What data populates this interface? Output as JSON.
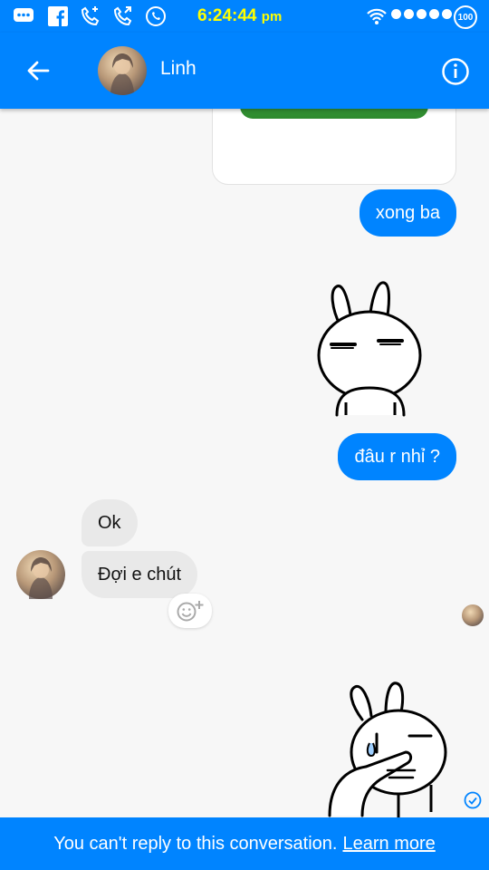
{
  "status_bar": {
    "time": "6:24:44",
    "ampm": "pm",
    "battery": "100",
    "icons": [
      "chat-bubble-icon",
      "facebook-icon",
      "call-icon",
      "call-icon",
      "whatsapp-icon",
      "wifi-icon",
      "signal-icon",
      "battery-icon"
    ]
  },
  "header": {
    "contact_name": "Linh",
    "back_icon": "arrow-left-icon",
    "info_icon": "info-icon"
  },
  "messages": [
    {
      "side": "out",
      "type": "text",
      "text": "xong ba"
    },
    {
      "side": "out",
      "type": "sticker",
      "sticker": "bunny-squint-sticker"
    },
    {
      "side": "out",
      "type": "text",
      "text": "đâu r nhỉ ?"
    },
    {
      "side": "in",
      "type": "text",
      "text": "Ok"
    },
    {
      "side": "in",
      "type": "text",
      "text": "Đợi e chút"
    },
    {
      "side": "out",
      "type": "sticker",
      "sticker": "bunny-facepalm-sticker"
    }
  ],
  "footer": {
    "notice": "You can't reply to this conversation.",
    "link": "Learn more"
  },
  "colors": {
    "brand": "#0084ff",
    "incoming_bubble": "#e9e9e9",
    "time_text": "#ffff00"
  }
}
